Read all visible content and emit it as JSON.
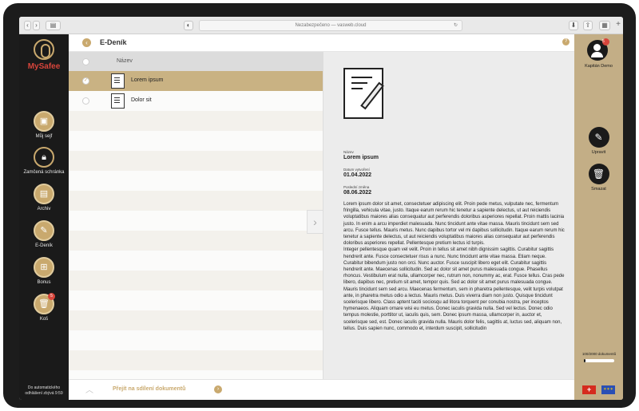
{
  "browser": {
    "url_text": "Nezabezpečeno — vasweb.cloud"
  },
  "app": {
    "name": "MySafee",
    "page_title": "E-Deník"
  },
  "sidebar": {
    "items": [
      {
        "label": "Můj sejf",
        "icon": "safe-icon",
        "badge": ""
      },
      {
        "label": "Zamčená schránka",
        "icon": "lock-icon",
        "badge": ""
      },
      {
        "label": "Archiv",
        "icon": "archive-icon",
        "badge": ""
      },
      {
        "label": "E-Deník",
        "icon": "diary-icon",
        "badge": ""
      },
      {
        "label": "Bonus",
        "icon": "gift-icon",
        "badge": ""
      },
      {
        "label": "Koš",
        "icon": "trash-icon",
        "badge": "5"
      }
    ],
    "footer_text": "Do automatického odhlášení zbývá 9:59"
  },
  "list": {
    "column_header": "Název",
    "rows": [
      {
        "name": "Lorem ipsum",
        "selected": true
      },
      {
        "name": "Dolor sit",
        "selected": false
      }
    ]
  },
  "detail": {
    "name_label": "Název",
    "name_value": "Lorem ipsum",
    "created_label": "Datum vytvoření",
    "created_value": "01.04.2022",
    "modified_label": "Poslední změna",
    "modified_value": "08.06.2022",
    "content_paragraphs": [
      "Lorem ipsum dolor sit amet, consectetuer adipiscing elit. Proin pede metus, vulputate nec, fermentum fringilla, vehicula vitae, justo. Itaque earum rerum hic tenetur a sapiente delectus, ut aut reiciendis voluptatibus maiores alias consequatur aut perferendis doloribus asperiores repellat. Proin mattis lacinia justo. In enim a arcu imperdiet malesuada. Nunc tincidunt ante vitae massa. Mauris tincidunt sem sed arcu. Fusce tellus. Mauris metus. Nunc dapibus tortor vel mi dapibus sollicitudin. Itaque earum rerum hic tenetur a sapiente delectus, ut aut reiciendis voluptatibus maiores alias consequatur aut perferendis doloribus asperiores repellat. Pellentesque pretium lectus id turpis.",
      "Integer pellentesque quam vel velit. Proin in tellus sit amet nibh dignissim sagittis. Curabitur sagittis hendrerit ante. Fusce consectetuer risus a nunc. Nunc tincidunt ante vitae massa. Etiam neque. Curabitur bibendum justo non orci. Nunc auctor. Fusce suscipit libero eget elit. Curabitur sagittis hendrerit ante. Maecenas sollicitudin. Sed ac dolor sit amet purus malesuada congue. Phasellus rhoncus. Vestibulum erat nulla, ullamcorper nec, rutrum non, nonummy ac, erat. Fusce tellus. Cras pede libero, dapibus nec, pretium sit amet, tempor quis. Sed ac dolor sit amet purus malesuada congue.",
      "Mauris tincidunt sem sed arcu. Maecenas fermentum, sem in pharetra pellentesque, velit turpis volutpat ante, in pharetra metus odio a lectus. Mauris metus. Duis viverra diam non justo. Quisque tincidunt scelerisque libero. Class aptent taciti sociosqu ad litora torquent per conubia nostra, per inceptos hymenaeos. Aliquam ornare wisi eu metus. Donec iaculis gravida nulla. Sed vel lectus. Donec odio tempus molestie, porttitor ut, iaculis quis, sem. Donec ipsum massa, ullamcorper in, auctor et, scelerisque sed, est. Donec iaculis gravida nulla. Mauris dolor felis, sagittis at, luctus sed, aliquam non, tellus. Duis sapien nunc, commodo et, interdum suscipit, sollicitudin"
    ]
  },
  "user": {
    "name": "Kapitán Demo",
    "badge": "5"
  },
  "actions": [
    {
      "label": "Upravit",
      "icon": "pencil-icon"
    },
    {
      "label": "Smazat",
      "icon": "trash-icon"
    }
  ],
  "storage": {
    "text": "100/2000 dokumentů",
    "fraction": 0.05
  },
  "footer": {
    "share_label": "Přejít na sdílení dokumentů"
  },
  "colors": {
    "accent": "#c9a96e",
    "sidebar": "#1a1a1a",
    "brand_red": "#d7453b",
    "selected_row": "#c9b283",
    "right_panel": "#c3ae86"
  }
}
